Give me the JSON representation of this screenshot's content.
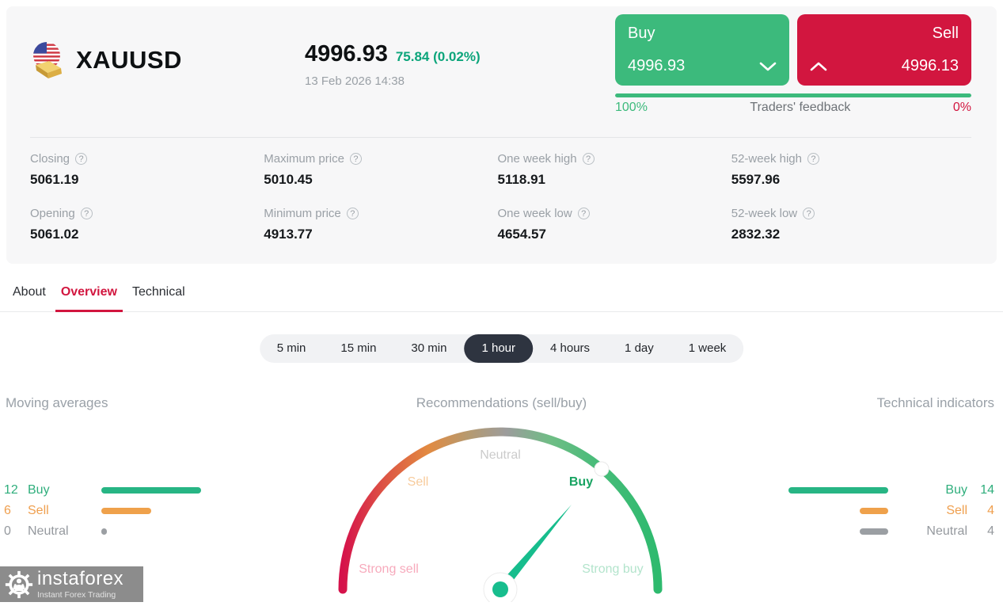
{
  "colors": {
    "buy_green": "#3cba7c",
    "sell_red": "#d2163f",
    "change_teal": "#0ca57b",
    "orange": "#efa14b",
    "neutral_gray": "#9b9fa3",
    "active_pill_bg": "#2e3440",
    "panel_bg": "#f7f7f8",
    "needle_green": "#17bd8d",
    "active_tab": "#d2163f"
  },
  "icons": {
    "help": "?"
  },
  "header": {
    "symbol": "XAUUSD",
    "price": "4996.93",
    "change": "75.84 (0.02%)",
    "datetime": "13 Feb 2026 14:38",
    "buy_button": {
      "label": "Buy",
      "price": "4996.93"
    },
    "sell_button": {
      "label": "Sell",
      "price": "4996.13"
    },
    "feedback": {
      "buy_percent": "100%",
      "label": "Traders' feedback",
      "sell_percent": "0%"
    }
  },
  "stats": [
    {
      "label": "Closing",
      "value": "5061.19"
    },
    {
      "label": "Maximum price",
      "value": "5010.45"
    },
    {
      "label": "One week high",
      "value": "5118.91"
    },
    {
      "label": "52-week high",
      "value": "5597.96"
    },
    {
      "label": "Opening",
      "value": "5061.02"
    },
    {
      "label": "Minimum price",
      "value": "4913.77"
    },
    {
      "label": "One week low",
      "value": "4654.57"
    },
    {
      "label": "52-week low",
      "value": "2832.32"
    }
  ],
  "tabs": [
    {
      "label": "About",
      "active": false
    },
    {
      "label": "Overview",
      "active": true
    },
    {
      "label": "Technical",
      "active": false
    }
  ],
  "periods": [
    {
      "label": "5 min",
      "active": false
    },
    {
      "label": "15 min",
      "active": false
    },
    {
      "label": "30 min",
      "active": false
    },
    {
      "label": "1 hour",
      "active": true
    },
    {
      "label": "4 hours",
      "active": false
    },
    {
      "label": "1 day",
      "active": false
    },
    {
      "label": "1 week",
      "active": false
    }
  ],
  "sections": {
    "moving_averages": "Moving averages",
    "recommendations": "Recommendations (sell/buy)",
    "technical_indicators": "Technical indicators"
  },
  "chart_data": [
    {
      "type": "bar",
      "title": "Moving averages",
      "categories": [
        "Buy",
        "Sell",
        "Neutral"
      ],
      "values": [
        12,
        6,
        0
      ],
      "colors": [
        "#27b584",
        "#efa14b",
        "#9b9fa3"
      ],
      "legend_position": "left"
    },
    {
      "type": "gauge",
      "title": "Recommendations (sell/buy)",
      "scale_labels": [
        "Strong sell",
        "Sell",
        "Neutral",
        "Buy",
        "Strong buy"
      ],
      "current": "Buy",
      "needle_angle_deg_above_horizontal": 50,
      "arc_colors": [
        "#d5124b",
        "#e28a41",
        "#9c9c9c",
        "#49bc7a",
        "#2eba6e"
      ]
    },
    {
      "type": "bar",
      "title": "Technical indicators",
      "categories": [
        "Buy",
        "Sell",
        "Neutral"
      ],
      "values": [
        14,
        4,
        4
      ],
      "colors": [
        "#27b584",
        "#efa14b",
        "#9b9fa3"
      ],
      "legend_position": "right"
    }
  ],
  "watermark": {
    "brand": "instaforex",
    "tagline": "Instant Forex Trading"
  }
}
